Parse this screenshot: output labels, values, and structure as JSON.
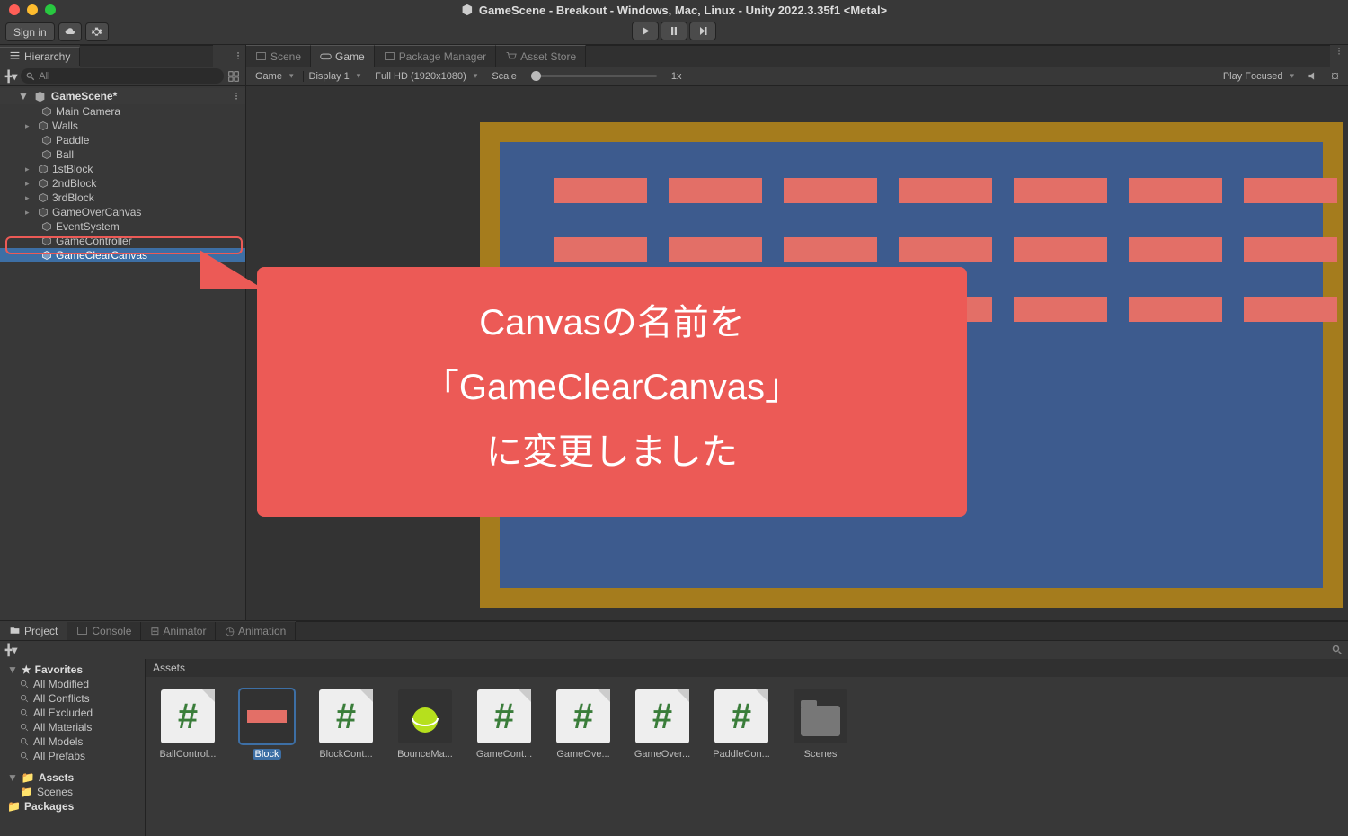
{
  "window": {
    "title": "GameScene - Breakout - Windows, Mac, Linux - Unity 2022.3.35f1 <Metal>"
  },
  "toolbar": {
    "signin": "Sign in"
  },
  "hierarchy": {
    "tab": "Hierarchy",
    "search_placeholder": "All",
    "scene": "GameScene*",
    "nodes": [
      "Main Camera",
      "Walls",
      "Paddle",
      "Ball",
      "1stBlock",
      "2ndBlock",
      "3rdBlock",
      "GameOverCanvas",
      "EventSystem",
      "GameController",
      "GameClearCanvas"
    ]
  },
  "viewTabs": {
    "scene": "Scene",
    "game": "Game",
    "package": "Package Manager",
    "asset": "Asset Store"
  },
  "gameToolbar": {
    "game": "Game",
    "display": "Display 1",
    "resolution": "Full HD (1920x1080)",
    "scale": "Scale",
    "scaleVal": "1x",
    "playFocused": "Play Focused"
  },
  "project": {
    "tabs": {
      "project": "Project",
      "console": "Console",
      "animator": "Animator",
      "animation": "Animation"
    },
    "tree": {
      "favorites": "Favorites",
      "items": [
        "All Modified",
        "All Conflicts",
        "All Excluded",
        "All Materials",
        "All Models",
        "All Prefabs"
      ],
      "assets": "Assets",
      "scenes": "Scenes",
      "packages": "Packages"
    },
    "assetsHeader": "Assets",
    "assets": [
      {
        "name": "BallControl...",
        "type": "script"
      },
      {
        "name": "Block",
        "type": "block"
      },
      {
        "name": "BlockCont...",
        "type": "script"
      },
      {
        "name": "BounceMa...",
        "type": "phys"
      },
      {
        "name": "GameCont...",
        "type": "script"
      },
      {
        "name": "GameOve...",
        "type": "script"
      },
      {
        "name": "GameOver...",
        "type": "script"
      },
      {
        "name": "PaddleCon...",
        "type": "script"
      },
      {
        "name": "Scenes",
        "type": "folder"
      }
    ]
  },
  "annotation": {
    "line1": "Canvasの名前を",
    "line2": "「GameClearCanvas」",
    "line3": "に変更しました"
  }
}
